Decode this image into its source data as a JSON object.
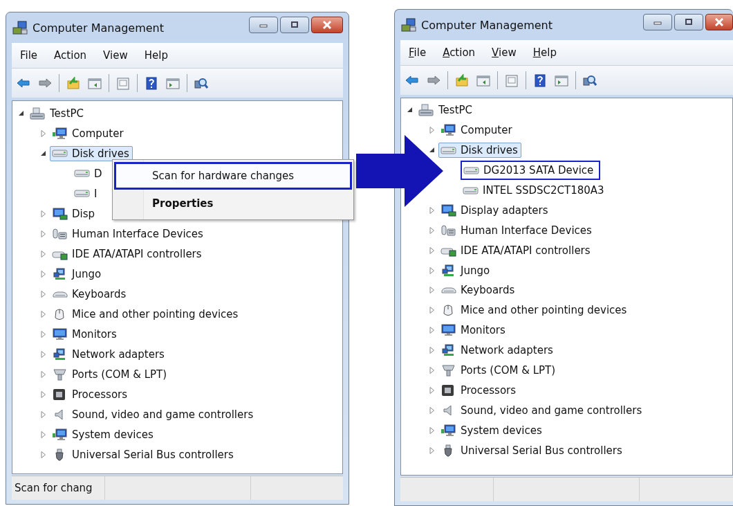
{
  "windows": [
    {
      "title": "Computer Management",
      "access_keys_shown": false,
      "menu": [
        {
          "label": "File"
        },
        {
          "label": "Action"
        },
        {
          "label": "View"
        },
        {
          "label": "Help"
        }
      ],
      "tree": [
        {
          "label": "TestPC",
          "kind": "pc",
          "expanded": true,
          "selected": false,
          "outlined": false,
          "children": [
            {
              "label": "Computer",
              "kind": "computer",
              "expanded": false,
              "selected": false,
              "outlined": false
            },
            {
              "label": "Disk drives",
              "kind": "disk",
              "expanded": true,
              "selected": true,
              "outlined": false,
              "children": [
                {
                  "label": "D",
                  "kind": "disk",
                  "selected": false,
                  "outlined": false
                },
                {
                  "label": "I",
                  "kind": "disk",
                  "selected": false,
                  "outlined": false
                }
              ]
            },
            {
              "label": "Disp",
              "kind": "display",
              "expanded": false,
              "selected": false,
              "outlined": false
            },
            {
              "label": "Human Interface Devices",
              "kind": "hid",
              "expanded": false,
              "selected": false,
              "outlined": false
            },
            {
              "label": "IDE ATA/ATAPI controllers",
              "kind": "ide",
              "expanded": false,
              "selected": false,
              "outlined": false
            },
            {
              "label": "Jungo",
              "kind": "network",
              "expanded": false,
              "selected": false,
              "outlined": false
            },
            {
              "label": "Keyboards",
              "kind": "keyboard",
              "expanded": false,
              "selected": false,
              "outlined": false
            },
            {
              "label": "Mice and other pointing devices",
              "kind": "mouse",
              "expanded": false,
              "selected": false,
              "outlined": false
            },
            {
              "label": "Monitors",
              "kind": "monitor",
              "expanded": false,
              "selected": false,
              "outlined": false
            },
            {
              "label": "Network adapters",
              "kind": "network",
              "expanded": false,
              "selected": false,
              "outlined": false
            },
            {
              "label": "Ports (COM & LPT)",
              "kind": "port",
              "expanded": false,
              "selected": false,
              "outlined": false
            },
            {
              "label": "Processors",
              "kind": "processor",
              "expanded": false,
              "selected": false,
              "outlined": false
            },
            {
              "label": "Sound, video and game controllers",
              "kind": "sound",
              "expanded": false,
              "selected": false,
              "outlined": false
            },
            {
              "label": "System devices",
              "kind": "computer",
              "expanded": false,
              "selected": false,
              "outlined": false
            },
            {
              "label": "Universal Serial Bus controllers",
              "kind": "usb",
              "expanded": false,
              "selected": false,
              "outlined": false
            }
          ]
        }
      ],
      "context_menu": {
        "items": [
          {
            "label": "Scan for hardware changes",
            "selected": true,
            "default": false
          },
          {
            "label": "Properties",
            "selected": false,
            "default": true
          }
        ]
      },
      "status_bar": {
        "text": "Scan for chang"
      }
    },
    {
      "title": "Computer Management",
      "access_keys_shown": true,
      "menu": [
        {
          "label": "File"
        },
        {
          "label": "Action"
        },
        {
          "label": "View"
        },
        {
          "label": "Help"
        }
      ],
      "tree": [
        {
          "label": "TestPC",
          "kind": "pc",
          "expanded": true,
          "selected": false,
          "outlined": false,
          "children": [
            {
              "label": "Computer",
              "kind": "computer",
              "expanded": false,
              "selected": false,
              "outlined": false
            },
            {
              "label": "Disk drives",
              "kind": "disk",
              "expanded": true,
              "selected": true,
              "outlined": false,
              "children": [
                {
                  "label": "DG2013 SATA Device",
                  "kind": "disk",
                  "selected": false,
                  "outlined": true
                },
                {
                  "label": "INTEL SSDSC2CT180A3",
                  "kind": "disk",
                  "selected": false,
                  "outlined": false
                }
              ]
            },
            {
              "label": "Display adapters",
              "kind": "display",
              "expanded": false,
              "selected": false,
              "outlined": false
            },
            {
              "label": "Human Interface Devices",
              "kind": "hid",
              "expanded": false,
              "selected": false,
              "outlined": false
            },
            {
              "label": "IDE ATA/ATAPI controllers",
              "kind": "ide",
              "expanded": false,
              "selected": false,
              "outlined": false
            },
            {
              "label": "Jungo",
              "kind": "network",
              "expanded": false,
              "selected": false,
              "outlined": false
            },
            {
              "label": "Keyboards",
              "kind": "keyboard",
              "expanded": false,
              "selected": false,
              "outlined": false
            },
            {
              "label": "Mice and other pointing devices",
              "kind": "mouse",
              "expanded": false,
              "selected": false,
              "outlined": false
            },
            {
              "label": "Monitors",
              "kind": "monitor",
              "expanded": false,
              "selected": false,
              "outlined": false
            },
            {
              "label": "Network adapters",
              "kind": "network",
              "expanded": false,
              "selected": false,
              "outlined": false
            },
            {
              "label": "Ports (COM & LPT)",
              "kind": "port",
              "expanded": false,
              "selected": false,
              "outlined": false
            },
            {
              "label": "Processors",
              "kind": "processor",
              "expanded": false,
              "selected": false,
              "outlined": false
            },
            {
              "label": "Sound, video and game controllers",
              "kind": "sound",
              "expanded": false,
              "selected": false,
              "outlined": false
            },
            {
              "label": "System devices",
              "kind": "computer",
              "expanded": false,
              "selected": false,
              "outlined": false
            },
            {
              "label": "Universal Serial Bus controllers",
              "kind": "usb",
              "expanded": false,
              "selected": false,
              "outlined": false
            }
          ]
        }
      ]
    }
  ]
}
